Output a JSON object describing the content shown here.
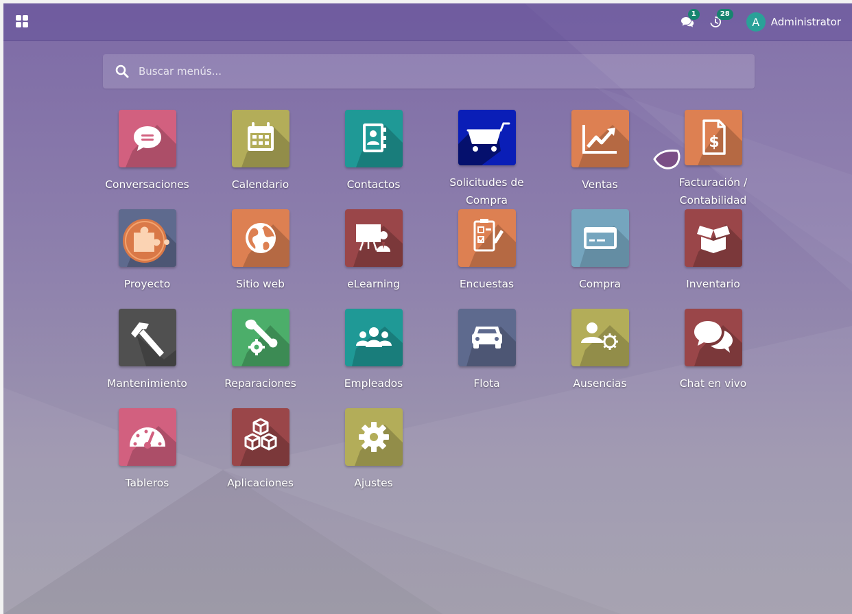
{
  "topbar": {
    "apps_menu_icon": "grid-icon",
    "messages_icon": "comments-icon",
    "messages_count": "1",
    "activities_icon": "clock-icon",
    "activities_count": "28",
    "user_initial": "A",
    "user_name": "Administrator"
  },
  "search": {
    "icon": "search-icon",
    "placeholder": "Buscar menús..."
  },
  "colors": {
    "badge": "#17846f",
    "avatar": "#2aa198"
  },
  "apps": [
    {
      "label": "Conversaciones",
      "icon": "chat-bubble-icon",
      "color": "#d2607f"
    },
    {
      "label": "Calendario",
      "icon": "calendar-icon",
      "color": "#b3ad59"
    },
    {
      "label": "Contactos",
      "icon": "address-book-icon",
      "color": "#1f9996"
    },
    {
      "label": "Solicitudes de Compra",
      "icon": "shopping-cart-icon",
      "color": "#0a1eb7"
    },
    {
      "label": "Ventas",
      "icon": "trend-chart-icon",
      "color": "#dd8052"
    },
    {
      "label": "Facturación / Contabilidad",
      "icon": "invoice-dollar-icon",
      "color": "#dd8052"
    },
    {
      "label": "Proyecto",
      "icon": "puzzle-piece-icon",
      "color": "#5e6a8e"
    },
    {
      "label": "Sitio web",
      "icon": "globe-icon",
      "color": "#dd8052"
    },
    {
      "label": "eLearning",
      "icon": "presentation-board-icon",
      "color": "#9a4649"
    },
    {
      "label": "Encuestas",
      "icon": "survey-clipboard-icon",
      "color": "#dd8052"
    },
    {
      "label": "Compra",
      "icon": "credit-card-icon",
      "color": "#75a5be"
    },
    {
      "label": "Inventario",
      "icon": "open-box-icon",
      "color": "#9a4649"
    },
    {
      "label": "Mantenimiento",
      "icon": "hammer-icon",
      "color": "#505050"
    },
    {
      "label": "Reparaciones",
      "icon": "wrench-gear-icon",
      "color": "#4cae6a"
    },
    {
      "label": "Empleados",
      "icon": "people-group-icon",
      "color": "#1f9996"
    },
    {
      "label": "Flota",
      "icon": "car-icon",
      "color": "#5e6a8e"
    },
    {
      "label": "Ausencias",
      "icon": "user-gear-icon",
      "color": "#b3ad59"
    },
    {
      "label": "Chat en vivo",
      "icon": "chat-bubbles-icon",
      "color": "#9a4649"
    },
    {
      "label": "Tableros",
      "icon": "speedometer-icon",
      "color": "#d2607f"
    },
    {
      "label": "Aplicaciones",
      "icon": "cubes-icon",
      "color": "#9a4649"
    },
    {
      "label": "Ajustes",
      "icon": "gear-icon",
      "color": "#b3ad59"
    }
  ]
}
